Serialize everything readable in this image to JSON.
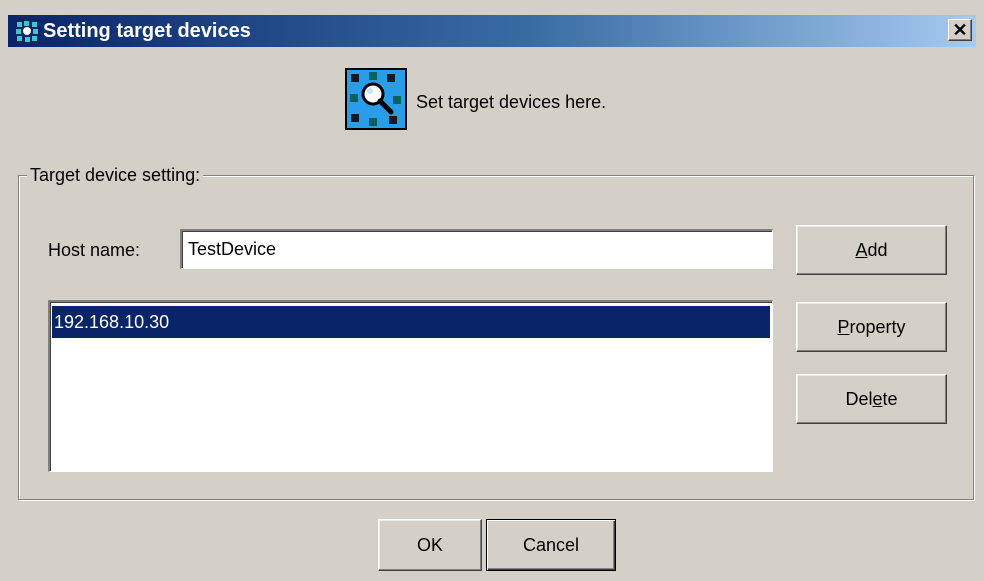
{
  "window": {
    "title": "Setting target devices",
    "close_glyph": "✕",
    "icon": "network-devices-icon"
  },
  "header": {
    "icon": "device-search-icon",
    "text": "Set target devices here."
  },
  "group": {
    "legend": "Target device setting:",
    "host_label": "Host name:",
    "host_value": "TestDevice",
    "devices": [
      "192.168.10.30"
    ],
    "selected_device": "192.168.10.30"
  },
  "buttons": {
    "add": {
      "label": "Add",
      "mnemonic": "A"
    },
    "property": {
      "label": "Property",
      "mnemonic": "P"
    },
    "delete": {
      "label": "Delete",
      "mnemonic": "e"
    },
    "ok": "OK",
    "cancel": "Cancel"
  },
  "colors": {
    "title_active": "#0a246a",
    "selection": "#0a246a",
    "face": "#d4d0c8"
  }
}
